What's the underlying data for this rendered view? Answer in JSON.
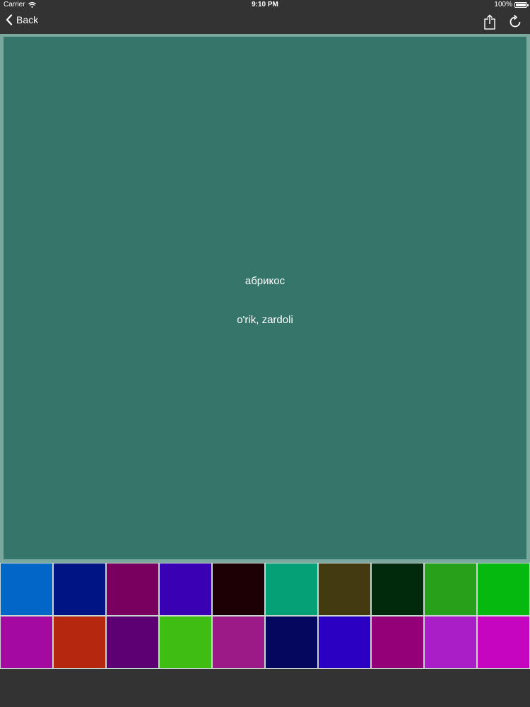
{
  "status_bar": {
    "carrier": "Carrier",
    "time": "9:10 PM",
    "battery_text": "100%",
    "battery_level": 1.0
  },
  "nav": {
    "back_label": "Back",
    "icons": [
      "chevron-left-icon",
      "share-icon",
      "refresh-icon"
    ]
  },
  "card": {
    "background": "#35756a",
    "border": "#7aa89e",
    "word_russian": "абрикос",
    "word_uzbek": "o'rik, zardoli"
  },
  "palette": {
    "colors": [
      "#0066c8",
      "#001583",
      "#7a005f",
      "#3a00b4",
      "#1c0005",
      "#05a076",
      "#433a10",
      "#002a0b",
      "#27a01a",
      "#05b90f",
      "#a40aa0",
      "#b5280f",
      "#5c0074",
      "#3fbd12",
      "#9b1a88",
      "#05075f",
      "#2c00c3",
      "#930078",
      "#aa1ec8",
      "#c505bf"
    ]
  }
}
